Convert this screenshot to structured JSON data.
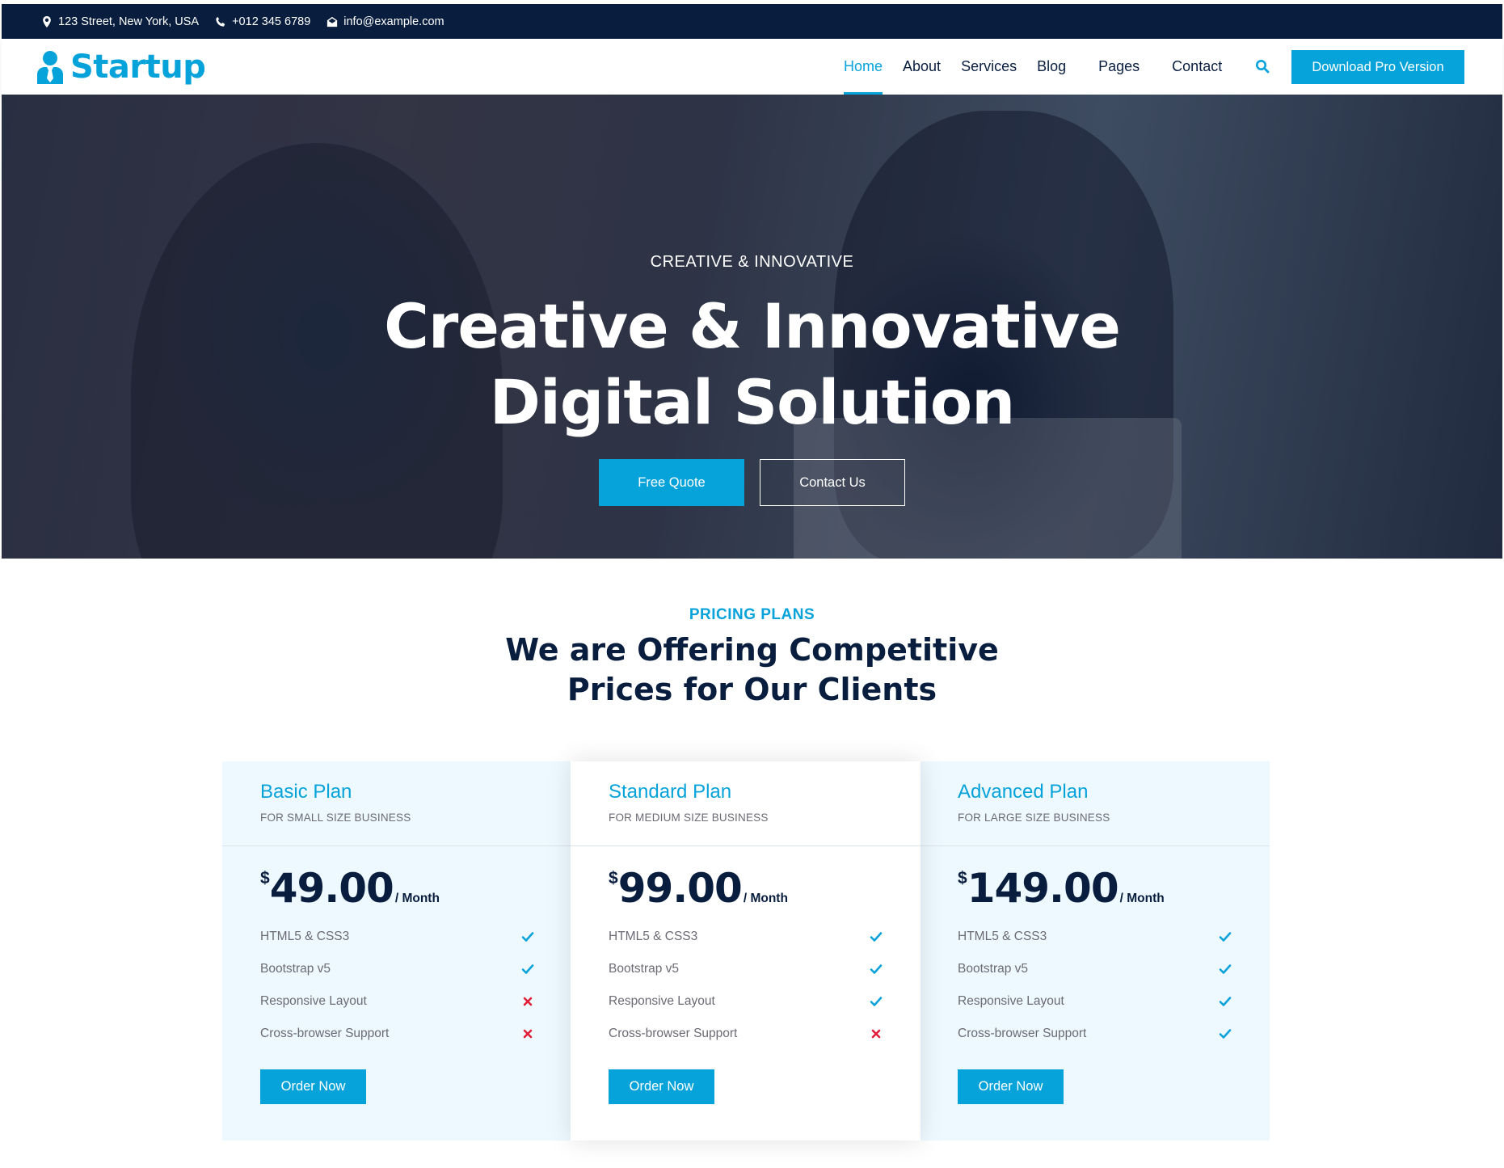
{
  "topbar": {
    "address": "123 Street, New York, USA",
    "phone": "+012 345 6789",
    "email": "info@example.com"
  },
  "brand": {
    "name": "Startup"
  },
  "nav": {
    "items": [
      {
        "label": "Home",
        "active": true
      },
      {
        "label": "About"
      },
      {
        "label": "Services"
      },
      {
        "label": "Blog"
      },
      {
        "label": "Pages"
      },
      {
        "label": "Contact"
      }
    ],
    "cta": "Download Pro Version"
  },
  "hero": {
    "subtitle": "CREATIVE & INNOVATIVE",
    "title_line1": "Creative & Innovative",
    "title_line2": "Digital Solution",
    "primary_button": "Free Quote",
    "secondary_button": "Contact Us"
  },
  "pricing": {
    "subtitle": "PRICING PLANS",
    "title_line1": "We are Offering Competitive",
    "title_line2": "Prices for Our Clients",
    "plans": [
      {
        "name": "Basic Plan",
        "tag": "FOR SMALL SIZE BUSINESS",
        "currency": "$",
        "price": "49.00",
        "period": "/ Month",
        "features": [
          {
            "label": "HTML5 & CSS3",
            "included": true
          },
          {
            "label": "Bootstrap v5",
            "included": true
          },
          {
            "label": "Responsive Layout",
            "included": false
          },
          {
            "label": "Cross-browser Support",
            "included": false
          }
        ],
        "button": "Order Now"
      },
      {
        "name": "Standard Plan",
        "tag": "FOR MEDIUM SIZE BUSINESS",
        "currency": "$",
        "price": "99.00",
        "period": "/ Month",
        "features": [
          {
            "label": "HTML5 & CSS3",
            "included": true
          },
          {
            "label": "Bootstrap v5",
            "included": true
          },
          {
            "label": "Responsive Layout",
            "included": true
          },
          {
            "label": "Cross-browser Support",
            "included": false
          }
        ],
        "button": "Order Now"
      },
      {
        "name": "Advanced Plan",
        "tag": "FOR LARGE SIZE BUSINESS",
        "currency": "$",
        "price": "149.00",
        "period": "/ Month",
        "features": [
          {
            "label": "HTML5 & CSS3",
            "included": true
          },
          {
            "label": "Bootstrap v5",
            "included": true
          },
          {
            "label": "Responsive Layout",
            "included": true
          },
          {
            "label": "Cross-browser Support",
            "included": true
          }
        ],
        "button": "Order Now"
      }
    ]
  },
  "colors": {
    "primary": "#06a3da",
    "dark": "#091e3e",
    "light": "#eef9ff",
    "check": "#06a3da",
    "cross": "#e31e3a"
  },
  "icons": {
    "address": "map-marker-icon",
    "phone": "phone-icon",
    "email": "envelope-open-icon",
    "brand": "user-tie-icon",
    "search": "search-icon",
    "included": "check-icon",
    "excluded": "times-icon"
  }
}
